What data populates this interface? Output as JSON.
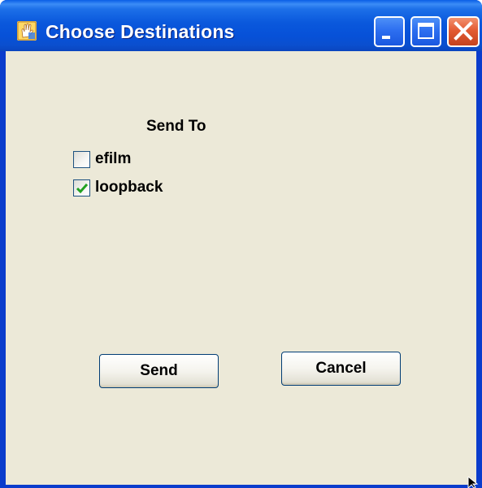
{
  "window": {
    "title": "Choose Destinations",
    "controls": [
      "minimize-icon",
      "maximize-icon",
      "close-icon"
    ]
  },
  "dialog": {
    "section_label": "Send To",
    "destinations": [
      {
        "label": "efilm",
        "checked": false
      },
      {
        "label": "loopback",
        "checked": true
      }
    ],
    "buttons": {
      "send_label": "Send",
      "cancel_label": "Cancel"
    }
  },
  "colors": {
    "titlebar": "#0a58dc",
    "client_background": "#ece9d8",
    "close_button": "#e35b33",
    "checkmark": "#21a121"
  }
}
